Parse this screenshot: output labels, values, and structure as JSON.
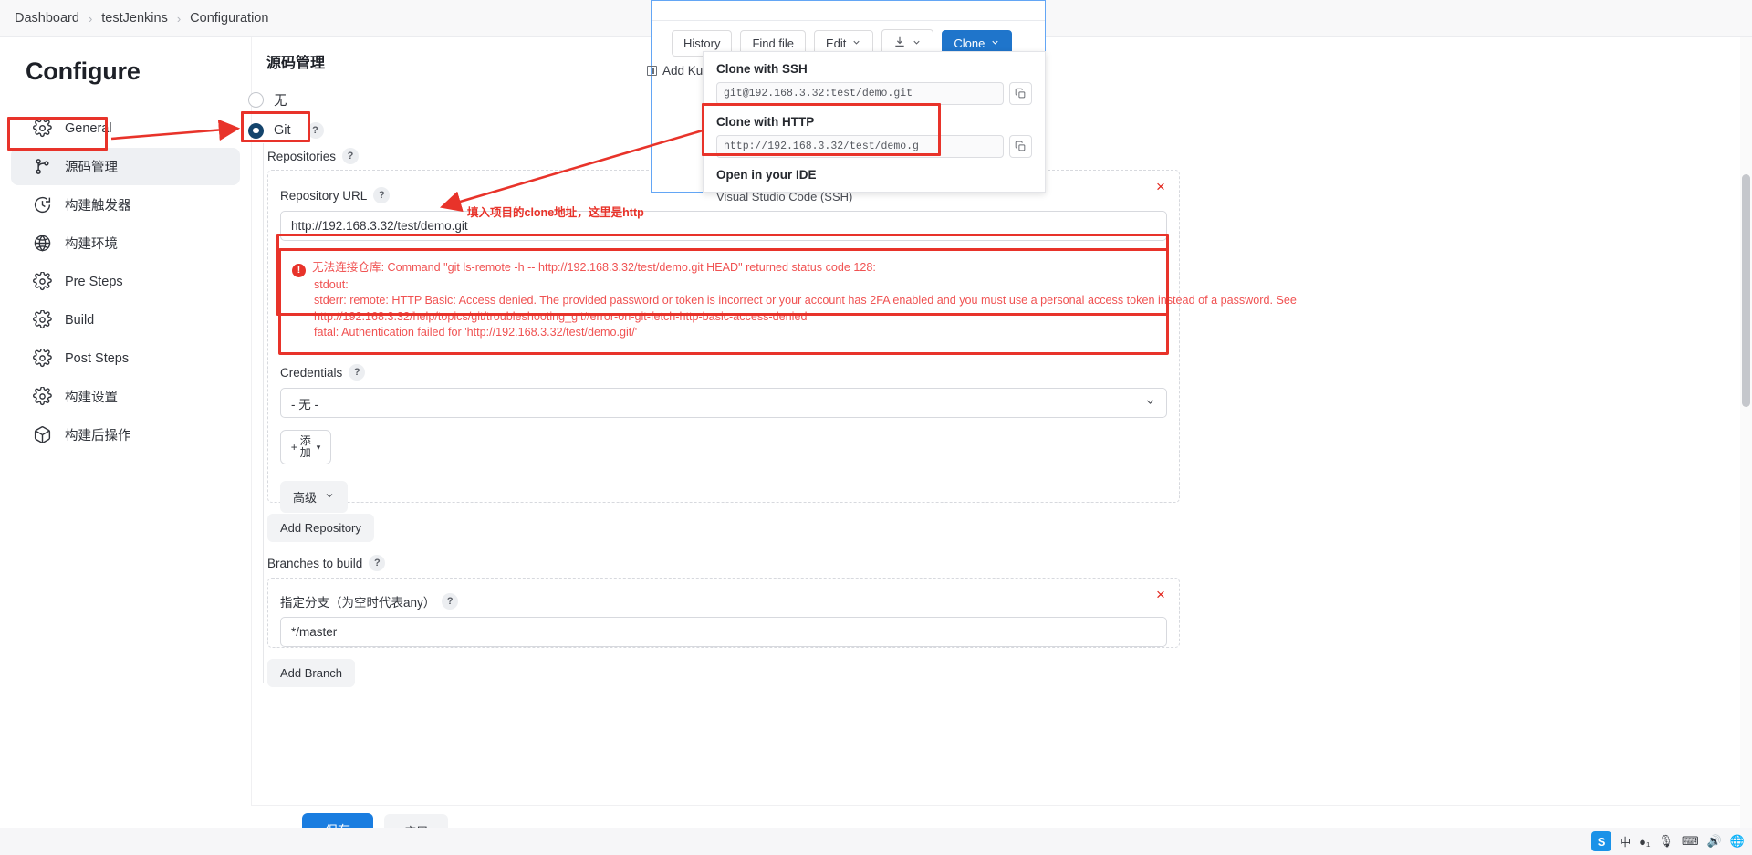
{
  "breadcrumb": {
    "items": [
      "Dashboard",
      "testJenkins",
      "Configuration"
    ],
    "separator": "›"
  },
  "sidebar": {
    "title": "Configure",
    "items": [
      {
        "label": "General",
        "icon": "gear-icon",
        "active": false
      },
      {
        "label": "源码管理",
        "icon": "branch-icon",
        "active": true
      },
      {
        "label": "构建触发器",
        "icon": "clock-icon",
        "active": false
      },
      {
        "label": "构建环境",
        "icon": "globe-icon",
        "active": false
      },
      {
        "label": "Pre Steps",
        "icon": "gear-icon",
        "active": false
      },
      {
        "label": "Build",
        "icon": "gear-icon",
        "active": false
      },
      {
        "label": "Post Steps",
        "icon": "gear-icon",
        "active": false
      },
      {
        "label": "构建设置",
        "icon": "gear-icon",
        "active": false
      },
      {
        "label": "构建后操作",
        "icon": "box-icon",
        "active": false
      }
    ]
  },
  "main": {
    "section_title": "源码管理",
    "scm_options": [
      {
        "label": "无",
        "selected": false
      },
      {
        "label": "Git",
        "selected": true
      }
    ],
    "repositories_label": "Repositories",
    "repository_url_label": "Repository URL",
    "repository_url_value": "http://192.168.3.32/test/demo.git",
    "help_glyph": "?",
    "error": {
      "icon": "error-icon",
      "title": "无法连接仓库:",
      "line1_rest": " Command \"git ls-remote -h -- http://192.168.3.32/test/demo.git HEAD\" returned status code 128:",
      "line2": "stdout:",
      "line3": "stderr: remote: HTTP Basic: Access denied. The provided password or token is incorrect or your account has 2FA enabled and you must use a personal access token instead of a password. See",
      "line4": "http://192.168.3.32/help/topics/git/troubleshooting_git#error-on-git-fetch-http-basic-access-denied",
      "line5": "fatal: Authentication failed for 'http://192.168.3.32/test/demo.git/'"
    },
    "credentials_label": "Credentials",
    "credentials_value": "- 无 -",
    "add_button": "添加",
    "add_plus": "+",
    "advanced_button": "高级",
    "add_repository_button": "Add Repository",
    "branches_label": "Branches to build",
    "branch_spec_label": "指定分支（为空时代表any）",
    "branch_spec_value": "*/master",
    "add_branch_button": "Add Branch",
    "delete_glyph": "×"
  },
  "annotation": {
    "repo_url_note": "填入项目的clone地址，这里是http"
  },
  "popup": {
    "toolbar": [
      {
        "label": "History",
        "variant": "outline",
        "caret": false
      },
      {
        "label": "Find file",
        "variant": "outline",
        "caret": false
      },
      {
        "label": "Edit",
        "variant": "outline",
        "caret": true
      },
      {
        "label": "",
        "variant": "outline",
        "caret": true,
        "icon": "download-icon"
      },
      {
        "label": "Clone",
        "variant": "primary",
        "caret": true
      }
    ],
    "add_kubernetes_label": "Add Kuber",
    "clone_ssh_title": "Clone with SSH",
    "clone_ssh_value": "git@192.168.3.32:test/demo.git",
    "clone_http_title": "Clone with HTTP",
    "clone_http_value": "http://192.168.3.32/test/demo.g",
    "open_ide_title": "Open in your IDE",
    "ide_option": "Visual Studio Code (SSH)",
    "copy_icon": "copy-icon"
  },
  "footer": {
    "save_label": "保存",
    "apply_label": "应用"
  },
  "taskbar": {
    "ime_logo": "S",
    "ime_label": "中",
    "glyphs": [
      "●₁",
      "🎙",
      "⌨",
      "🔊",
      "🌐"
    ]
  },
  "colors": {
    "accent_blue": "#1a7de0",
    "annotation_red": "#e8332a",
    "error_text": "#f05252",
    "radio_selected": "#14446c",
    "gitlab_blue": "#1f75cb"
  }
}
